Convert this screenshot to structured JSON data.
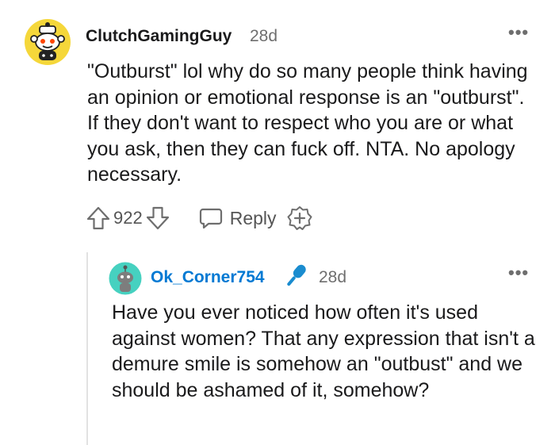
{
  "comment": {
    "username": "ClutchGamingGuy",
    "age": "28d",
    "more_icon": "•••",
    "body": "\"Outburst\" lol why do so many people think having an opinion or emotional response is an \"outburst\". If they don't want to respect who you are or what you ask, then they can fuck off. NTA. No apology necessary.",
    "score": "922",
    "reply_label": "Reply",
    "icons": {
      "avatar": "snoo-avatar-yellow",
      "upvote": "upvote-arrow-icon",
      "downvote": "downvote-arrow-icon",
      "reply": "speech-bubble-icon",
      "award": "award-plus-icon"
    }
  },
  "reply": {
    "username": "Ok_Corner754",
    "age": "28d",
    "more_icon": "•••",
    "body": "Have you ever noticed how often it's used against women? That any expression that isn't a demure smile is somehow an \"outbust\" and we should be ashamed of it, somehow?",
    "icons": {
      "avatar": "snoo-avatar-teal",
      "badge": "microphone-icon"
    }
  },
  "colors": {
    "text": "#1a1a1b",
    "muted": "#6e6e6e",
    "link_blue": "#0079d3",
    "avatar_yellow": "#f5d73a",
    "avatar_teal": "#46d1c0",
    "thread_line": "#e2e2e2"
  }
}
